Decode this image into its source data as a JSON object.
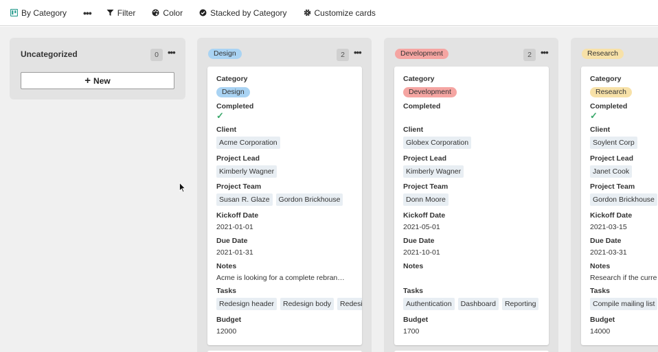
{
  "toolbar": {
    "view_label": "By Category",
    "more_label": "•••",
    "filter_label": "Filter",
    "color_label": "Color",
    "stacked_label": "Stacked by Category",
    "customize_label": "Customize cards"
  },
  "columns": {
    "uncategorized": {
      "title": "Uncategorized",
      "count": "0",
      "new_label": "New"
    },
    "design": {
      "title": "Design",
      "count": "2"
    },
    "development": {
      "title": "Development",
      "count": "2"
    },
    "research": {
      "title": "Research"
    }
  },
  "labels": {
    "category": "Category",
    "completed": "Completed",
    "client": "Client",
    "project_lead": "Project Lead",
    "project_team": "Project Team",
    "kickoff_date": "Kickoff Date",
    "due_date": "Due Date",
    "notes": "Notes",
    "tasks": "Tasks",
    "budget": "Budget",
    "dots": "•••",
    "check": "✓"
  },
  "cards": [
    {
      "category": "Design",
      "completed": true,
      "client": "Acme Corporation",
      "project_lead": "Kimberly Wagner",
      "project_team": [
        "Susan R. Glaze",
        "Gordon Brickhouse"
      ],
      "kickoff_date": "2021-01-01",
      "due_date": "2021-01-31",
      "notes": "Acme is looking for a complete rebran…",
      "tasks": [
        "Redesign header",
        "Redesign body",
        "Redesi"
      ],
      "budget": "12000"
    },
    {
      "category": "Development",
      "completed": false,
      "client": "Globex Corporation",
      "project_lead": "Kimberly Wagner",
      "project_team": [
        "Donn Moore"
      ],
      "kickoff_date": "2021-05-01",
      "due_date": "2021-10-01",
      "notes": "",
      "tasks": [
        "Authentication",
        "Dashboard",
        "Reporting"
      ],
      "budget": "1700"
    },
    {
      "category": "Research",
      "completed": true,
      "client": "Soylent Corp",
      "project_lead": "Janet Cook",
      "project_team": [
        "Gordon Brickhouse"
      ],
      "kickoff_date": "2021-03-15",
      "due_date": "2021-03-31",
      "notes": "Research if the curre",
      "tasks": [
        "Compile mailing list"
      ],
      "budget": "14000"
    }
  ],
  "colors": {
    "design": "#a9d3f3",
    "development": "#f5a5a2",
    "research": "#f7e1a8",
    "check": "#3aa86b",
    "chip": "#e8eef3"
  },
  "icons": {
    "view": "board-icon",
    "filter": "filter-icon",
    "color": "palette-icon",
    "stacked": "check-circle-icon",
    "customize": "gear-icon",
    "new": "plus-icon"
  }
}
